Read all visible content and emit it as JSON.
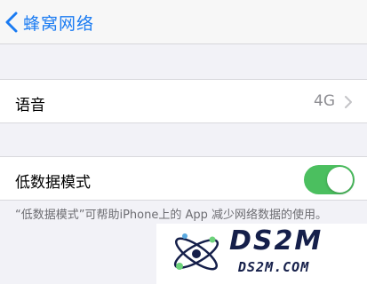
{
  "nav": {
    "back_label": "蜂窝网络"
  },
  "voice": {
    "label": "语音",
    "value": "4G"
  },
  "low_data": {
    "label": "低数据模式",
    "enabled": true,
    "footnote": "“低数据模式”可帮助iPhone上的 App 减少网络数据的使用。"
  },
  "watermark": {
    "title": "DS2M",
    "subtitle": "DS2M.COM"
  },
  "colors": {
    "accent": "#1a7bf2",
    "switch_on": "#4bbf5f",
    "watermark": "#151f4a"
  }
}
